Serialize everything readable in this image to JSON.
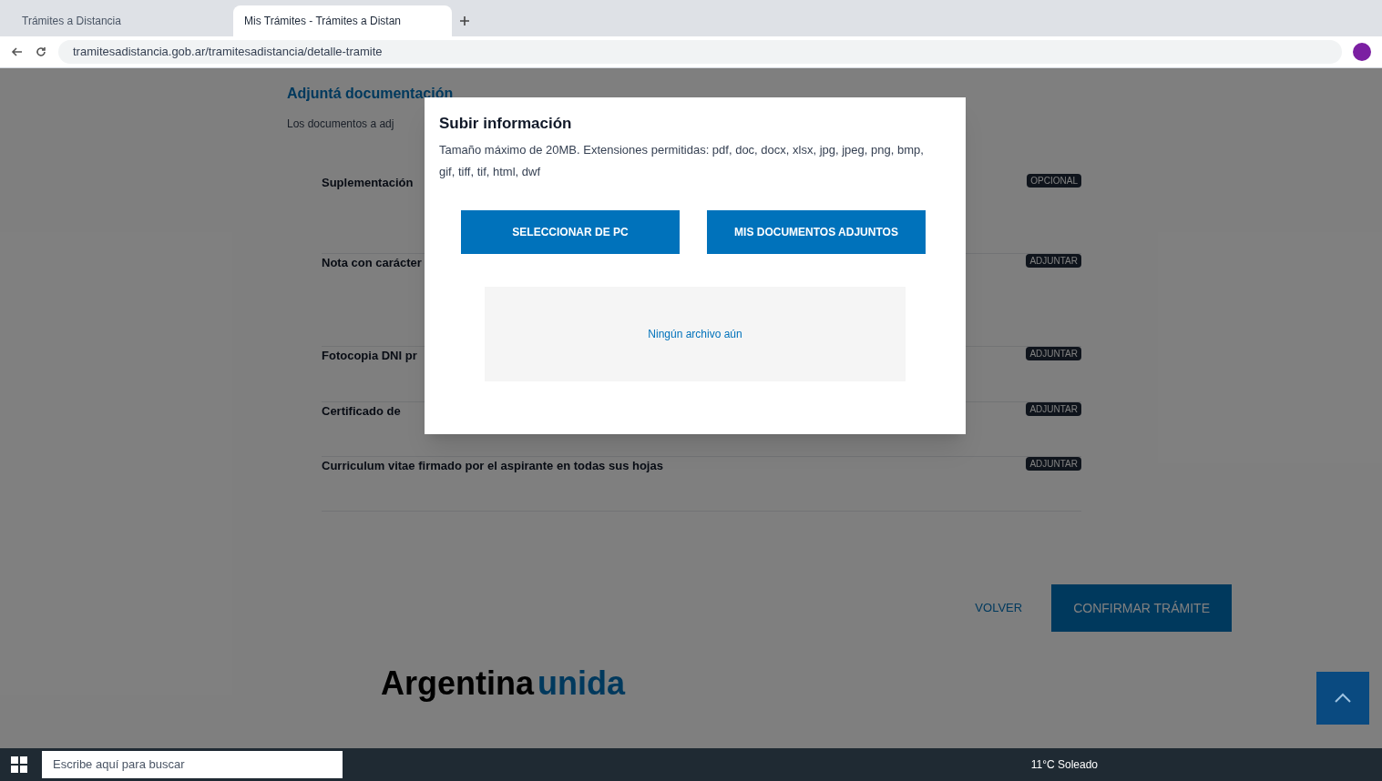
{
  "browser": {
    "tabs": [
      {
        "title": "Trámites a Distancia",
        "selected": false
      },
      {
        "title": "Mis Trámites - Trámites a Distan",
        "selected": true
      }
    ],
    "url": "tramitesadistancia.gob.ar/tramitesadistancia/detalle-tramite"
  },
  "page": {
    "heading": "Adjuntá documentación",
    "subheading": "Los documentos a adj",
    "documents": [
      {
        "label": "Suplementación",
        "badge": "OPCIONAL"
      },
      {
        "label": "Nota con carácter",
        "badge": "ADJUNTAR"
      },
      {
        "label": "Fotocopia DNI pr",
        "badge": "ADJUNTAR"
      },
      {
        "label": "Certificado de",
        "badge": "ADJUNTAR"
      },
      {
        "label": "Curriculum vitae firmado por el aspirante en todas sus hojas",
        "badge": "ADJUNTAR"
      }
    ],
    "back_link": "VOLVER",
    "confirm_button": "CONFIRMAR TRÁMITE",
    "footer_logo": [
      "Argentina",
      "unida"
    ]
  },
  "modal": {
    "title": "Subir información",
    "description": "Tamaño máximo de 20MB. Extensiones permitidas: pdf, doc, docx, xlsx, jpg, jpeg, png, bmp, gif, tiff, tif, html, dwf",
    "buttons": [
      "SELECCIONAR DE PC",
      "MIS DOCUMENTOS ADJUNTOS"
    ],
    "dropzone": "Ningún archivo aún"
  },
  "taskbar": {
    "search_placeholder": "Escribe aquí para buscar",
    "weather": "11°C Soleado"
  }
}
